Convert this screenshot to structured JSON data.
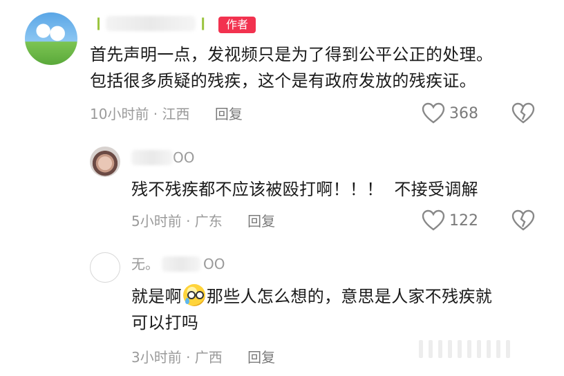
{
  "comments": [
    {
      "username": "",
      "badge": "作者",
      "text_line1": "首先声明一点，发视频只是为了得到公平公正的处理。",
      "text_line2": "包括很多质疑的残疾，这个是有政府发放的残疾证。",
      "time_location": "10小时前 · 江西",
      "reply_label": "回复",
      "likes": "368"
    },
    {
      "username": "OO",
      "text_line1": "残不残疾都不应该被殴打啊！！！  不接受调解",
      "time_location": "5小时前 · 广东",
      "reply_label": "回复",
      "likes": "122"
    },
    {
      "username_prefix": "无。",
      "username_suffix": "OO",
      "text_line1_before": "就是啊",
      "text_line1_after": "那些人怎么想的，意思是人家不残疾就",
      "text_line2": "可以打吗",
      "time_location": "3小时前 · 广西",
      "reply_label": "回复"
    }
  ],
  "icons": [
    "heart-icon",
    "broken-heart-icon",
    "badge-leaf-icon",
    "tear-emoji-icon"
  ],
  "colors": {
    "author_badge": "#f2324f",
    "meta_text": "#9a9a9a",
    "body_text": "#1a1a1a"
  }
}
